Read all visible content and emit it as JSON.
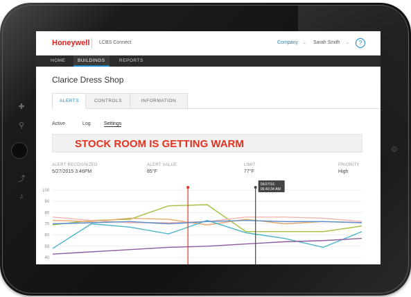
{
  "header": {
    "brand": "Honeywell",
    "app_name": "LCBS Connect",
    "company_label": "Company",
    "user_name": "Sarah Smith",
    "help_symbol": "?",
    "dropdown_caret": "⌄"
  },
  "nav": {
    "items": [
      {
        "label": "HOME",
        "active": false
      },
      {
        "label": "BUILDINGS",
        "active": true
      },
      {
        "label": "REPORTS",
        "active": false
      }
    ]
  },
  "site": {
    "title": "Clarice Dress Shop"
  },
  "tabs": [
    {
      "label": "ALERTS",
      "active": true
    },
    {
      "label": "CONTROLS",
      "active": false
    },
    {
      "label": "INFORMATION",
      "active": false
    }
  ],
  "subtabs": [
    {
      "label": "Active",
      "active": false
    },
    {
      "label": "Log",
      "active": false
    },
    {
      "label": "Settings",
      "active": true
    }
  ],
  "alert": {
    "message": "STOCK ROOM IS GETTING WARM",
    "recognized_label": "ALERT RECOGNIZED",
    "recognized_value": "5/27/2015 3:46PM",
    "value_label": "ALERT VALUE",
    "value_value": "85°F",
    "limit_label": "LIMIT",
    "limit_value": "77°F",
    "priority_label": "PRIORITY",
    "priority_value": "High"
  },
  "colors": {
    "brand_red": "#d9201c",
    "alert_red": "#e2321f",
    "accent_blue": "#1a86c7",
    "nav_dark": "#2b2b2b"
  },
  "chart_data": {
    "type": "line",
    "y_ticks": [
      "100",
      "90",
      "80",
      "70",
      "60",
      "50",
      "40"
    ],
    "ylim": [
      40,
      100
    ],
    "x": [
      0,
      1,
      2,
      3,
      4,
      5,
      6,
      7,
      8
    ],
    "grid": true,
    "markers": [
      {
        "name": "alert",
        "x": 3.5,
        "color": "#e2321f"
      },
      {
        "name": "cursor",
        "x": 5.25,
        "color": "#444444"
      }
    ],
    "tooltip": {
      "line1": "05/27/16",
      "line2": "06:40:34 AM"
    },
    "series": [
      {
        "color": "#9fc13f",
        "values": [
          69,
          73,
          74,
          86,
          87,
          63,
          63,
          63,
          68
        ]
      },
      {
        "color": "#e6a96c",
        "values": [
          73,
          72,
          75,
          74,
          69,
          74,
          70,
          72,
          71
        ]
      },
      {
        "color": "#f1b5b0",
        "values": [
          76,
          73,
          71,
          71,
          72,
          76,
          76,
          75,
          72
        ]
      },
      {
        "color": "#4cb4c7",
        "values": [
          48,
          70,
          67,
          61,
          73,
          62,
          57,
          49,
          63
        ]
      },
      {
        "color": "#8d5a9e",
        "values": [
          43,
          45,
          47,
          49,
          50,
          52,
          54,
          55,
          57
        ]
      },
      {
        "color": "#5a8ccb",
        "values": [
          70,
          71,
          72,
          70,
          72,
          73,
          72,
          72,
          71
        ]
      }
    ]
  }
}
